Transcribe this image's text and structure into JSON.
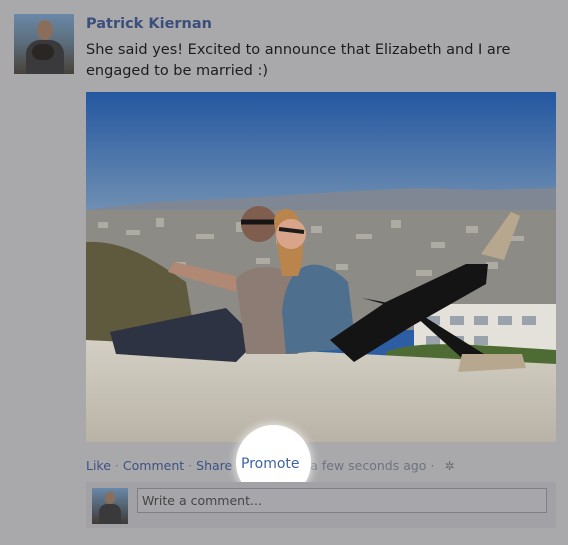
{
  "post": {
    "author": "Patrick Kiernan",
    "text": "She said yes! Excited to announce that Elizabeth and I are engaged to be married :)",
    "photo_alt": "Couple sitting back to back on a hilltop overlooking a city"
  },
  "actions": {
    "like": "Like",
    "comment": "Comment",
    "share": "Share",
    "promote": "Promote",
    "separator": "·",
    "timestamp": "a few seconds ago",
    "gear_icon": "gear-icon"
  },
  "comment_box": {
    "placeholder": "Write a comment..."
  },
  "colors": {
    "link": "#3d5283",
    "promote_link": "#3e63a6",
    "background": "#a9a9ab",
    "highlight": "#ffffff"
  }
}
